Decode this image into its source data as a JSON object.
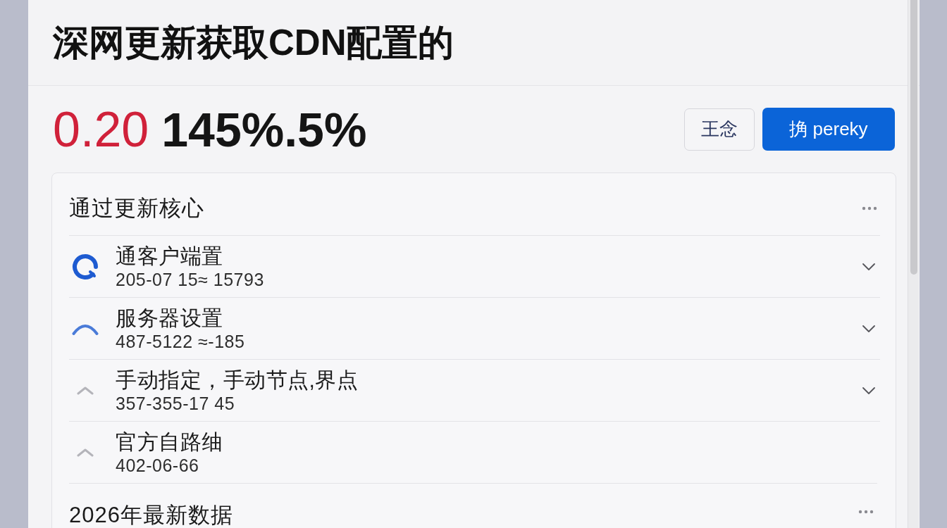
{
  "page": {
    "title": "深网更新获取CDN配置的"
  },
  "price": {
    "value": "0.20",
    "change": "145%.5%"
  },
  "buttons": [
    {
      "label": "王念",
      "kind": "outline"
    },
    {
      "label": "捔 pereky",
      "kind": "primary"
    }
  ],
  "card": {
    "sections": [
      {
        "title": "通过更新核心",
        "rows": [
          {
            "kind": "ring",
            "title": "通客户端置",
            "subtitle": "205-07 15≈ 15793",
            "expandable": true
          },
          {
            "kind": "arc",
            "title": "服务器设置",
            "subtitle": "487-5122 ≈-185",
            "expandable": true
          },
          {
            "kind": "caret",
            "title": "手动指定，手动节点,界点",
            "subtitle": "357-355-17 45",
            "expandable": true
          },
          {
            "kind": "caret",
            "title": "官方自路䌷",
            "subtitle": "402-06-66",
            "expandable": false
          }
        ]
      },
      {
        "title": "2026年最新数据"
      }
    ]
  }
}
